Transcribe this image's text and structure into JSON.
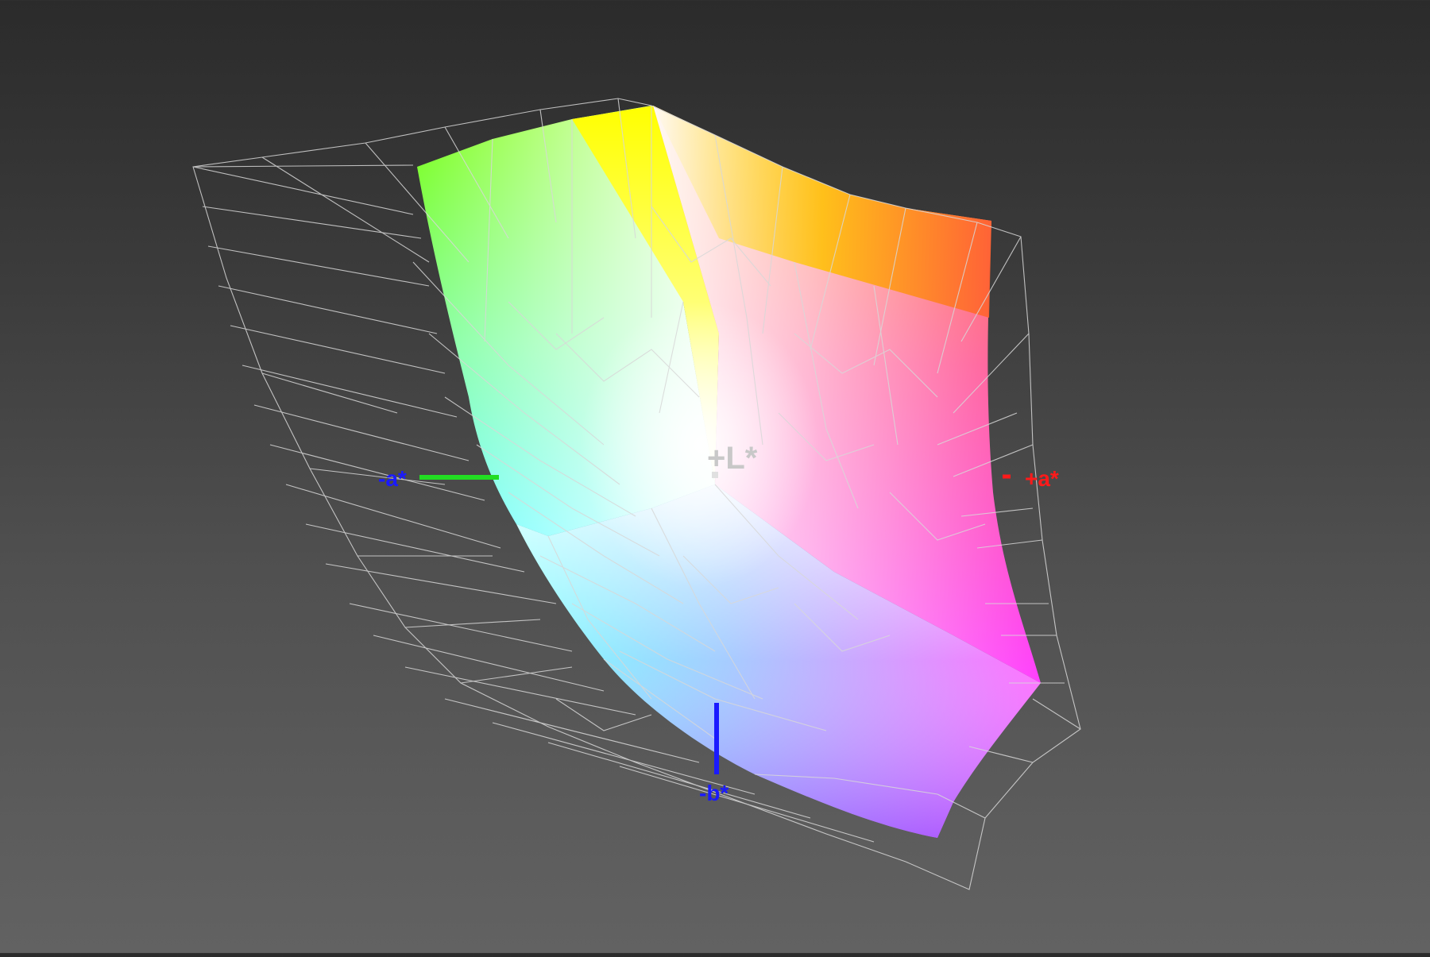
{
  "axes": {
    "plus_l": {
      "label": "+L*",
      "color": "#c8c8c8"
    },
    "minus_a": {
      "label": "-a*",
      "color": "#1a1aff",
      "line_color": "#22dd22"
    },
    "plus_a": {
      "label": "+a*",
      "color": "#ff1a1a",
      "line_color": "#ff1a1a"
    },
    "minus_b": {
      "label": "-b*",
      "color": "#1a1aff",
      "line_color": "#1a1aff"
    }
  },
  "gamut_colors": {
    "green": "#80ff10",
    "yellow": "#ffff00",
    "orange": "#ffb000",
    "red": "#ff6030",
    "white": "#ffffff",
    "cyan": "#60ffff",
    "magenta": "#ff40ff",
    "blue": "#8080ff",
    "violet": "#a060ff"
  },
  "wireframe_color": "#d8d8d8"
}
